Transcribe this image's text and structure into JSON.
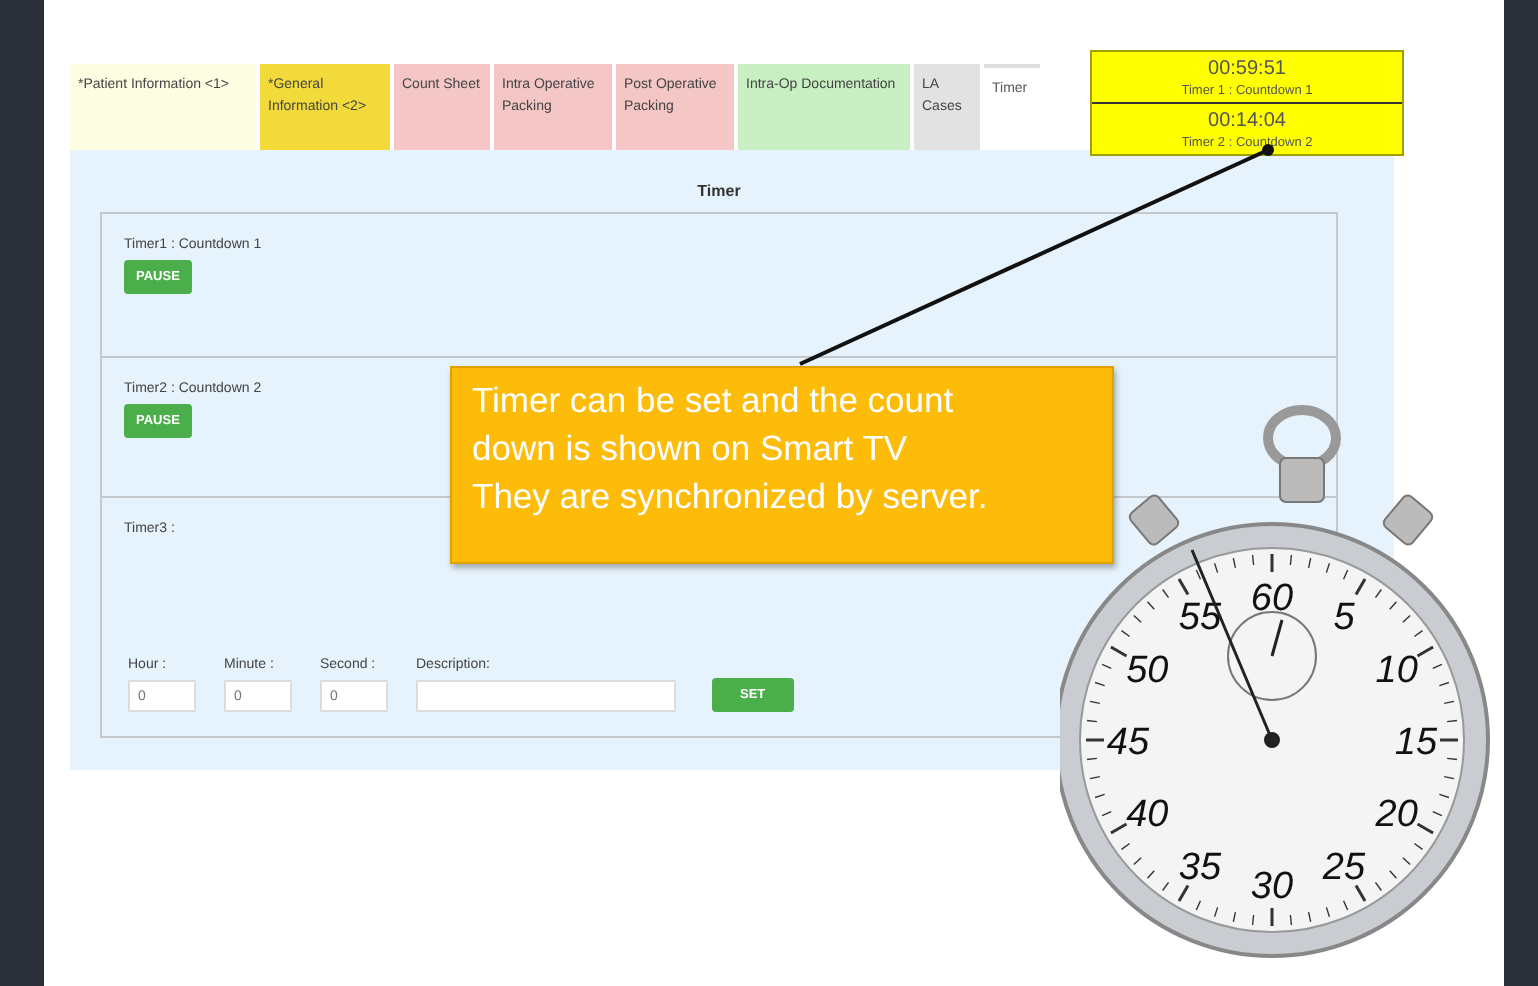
{
  "tabs": [
    {
      "label": "*Patient Information <1>",
      "color": "#fdfde2",
      "selected": false
    },
    {
      "label": "*General Information <2>",
      "color": "#f2da3a",
      "selected": false
    },
    {
      "label": "Count Sheet",
      "color": "#f4c6c6",
      "selected": false
    },
    {
      "label": "Intra Operative Packing",
      "color": "#f4c6c6",
      "selected": false
    },
    {
      "label": "Post Operative Packing",
      "color": "#f4c6c6",
      "selected": false
    },
    {
      "label": "Intra-Op Documentation",
      "color": "#c8efc2",
      "selected": false
    },
    {
      "label": "LA Cases",
      "color": "#e2e2e2",
      "selected": false
    },
    {
      "label": "Timer",
      "color": "#ffffff",
      "selected": true
    }
  ],
  "panel_title": "Timer",
  "timers": [
    {
      "label": "Timer1 : Countdown 1",
      "button": "PAUSE"
    },
    {
      "label": "Timer2 : Countdown 2",
      "button": "PAUSE"
    }
  ],
  "timer_setup": {
    "label": "Timer3 :",
    "fields": [
      {
        "label": "Hour :",
        "value": "0",
        "kind": "short"
      },
      {
        "label": "Minute :",
        "value": "0",
        "kind": "short"
      },
      {
        "label": "Second :",
        "value": "0",
        "kind": "short"
      },
      {
        "label": "Description:",
        "kind": "wide"
      }
    ],
    "button": "SET"
  },
  "tv_display": [
    {
      "time": "00:59:51",
      "caption": "Timer 1 : Countdown 1"
    },
    {
      "time": "00:14:04",
      "caption": "Timer 2 : Countdown 2"
    }
  ],
  "callout": {
    "lines": [
      "Timer can be set and the count",
      "down is shown on Smart TV",
      "They are synchronized by server."
    ]
  },
  "stopwatch": {
    "dial_numbers": [
      "60",
      "5",
      "10",
      "15",
      "20",
      "25",
      "30",
      "35",
      "40",
      "45",
      "50",
      "55"
    ]
  }
}
